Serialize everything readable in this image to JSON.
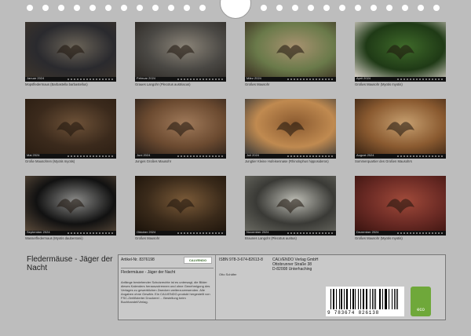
{
  "thumbnails": [
    {
      "month": "Januar 2024",
      "caption": "Mopsfledermaus (Barbastella barbastellus)",
      "colors": [
        "#2a2a2e",
        "#6b6458",
        "#3d352c"
      ]
    },
    {
      "month": "Februar 2024",
      "caption": "Graues Langohr (Plecotus austriacus)",
      "colors": [
        "#4a4844",
        "#8b8478",
        "#2b2723"
      ]
    },
    {
      "month": "März 2024",
      "caption": "Großes Mausohr",
      "colors": [
        "#6a7a4a",
        "#a89270",
        "#3b2f22"
      ]
    },
    {
      "month": "April 2024",
      "caption": "Großes Mausohr (Myotis myotis)",
      "colors": [
        "#1f3a16",
        "#3f6a2a",
        "#d8d0c8"
      ]
    },
    {
      "month": "Mai 2024",
      "caption": "Große Mausohren (Myotis myotis)",
      "colors": [
        "#3b2a1c",
        "#6e5238",
        "#2a1d12"
      ]
    },
    {
      "month": "Juni 2024",
      "caption": "Junges Großes Mausohr",
      "colors": [
        "#6b4a30",
        "#a07a5a",
        "#2a201a"
      ]
    },
    {
      "month": "Juli 2024",
      "caption": "Jungtier Kleine Hufeisennase (Rhinolophus hipposideros)",
      "colors": [
        "#c08a50",
        "#8a5a30",
        "#3a3a3a"
      ]
    },
    {
      "month": "August 2024",
      "caption": "Sommerquartier des Großen Mausohrs",
      "colors": [
        "#8a5a30",
        "#c7a070",
        "#3a2414"
      ]
    },
    {
      "month": "September 2024",
      "caption": "Wasserfledermaus (Myotis daubentonii)",
      "colors": [
        "#111111",
        "#8a8a88",
        "#5a4a3a"
      ]
    },
    {
      "month": "Oktober 2024",
      "caption": "Großes Mausohr",
      "colors": [
        "#3a2a1a",
        "#7a5a38",
        "#1a120a"
      ]
    },
    {
      "month": "November 2024",
      "caption": "Braunes Langohr (Plecotus auritus)",
      "colors": [
        "#3a3a36",
        "#bcbcb4",
        "#6a6a62"
      ]
    },
    {
      "month": "Dezember 2024",
      "caption": "Großes Mausohr (Myotis myotis)",
      "colors": [
        "#6a2a24",
        "#a04a3a",
        "#3a1410"
      ]
    }
  ],
  "title": "Fledermäuse - Jäger der Nacht",
  "info": {
    "article": "Artikel-Nr. 8376198",
    "logo": "CALVENDO",
    "calendar_title": "Fledermäuse - Jäger der Nacht",
    "description": "Anfänge bestehender Schutzrechte ist es untersagt, die Bilder dieses Kalenders herauszutrennen und ohne Genehmigung des Verlages zu gewerblichen Zwecken weiterzuverwenden. Alle Angaben ohne Gewähr. Ein CALVENDO-produkt hergestellt von FSC-Zertifizierter Druckerei ... Bestellung beim Buchhandel/Verlag.",
    "author": "Otto Schäfer",
    "isbn": "ISBN 978-3-674-82613-8",
    "publisher_lines": [
      "CALVENDO Verlag GmbH",
      "Ottobrunner Straße 38",
      "D-82008 Unterhaching"
    ],
    "barcode_number": "9 783674 826138",
    "eco": "eco"
  }
}
